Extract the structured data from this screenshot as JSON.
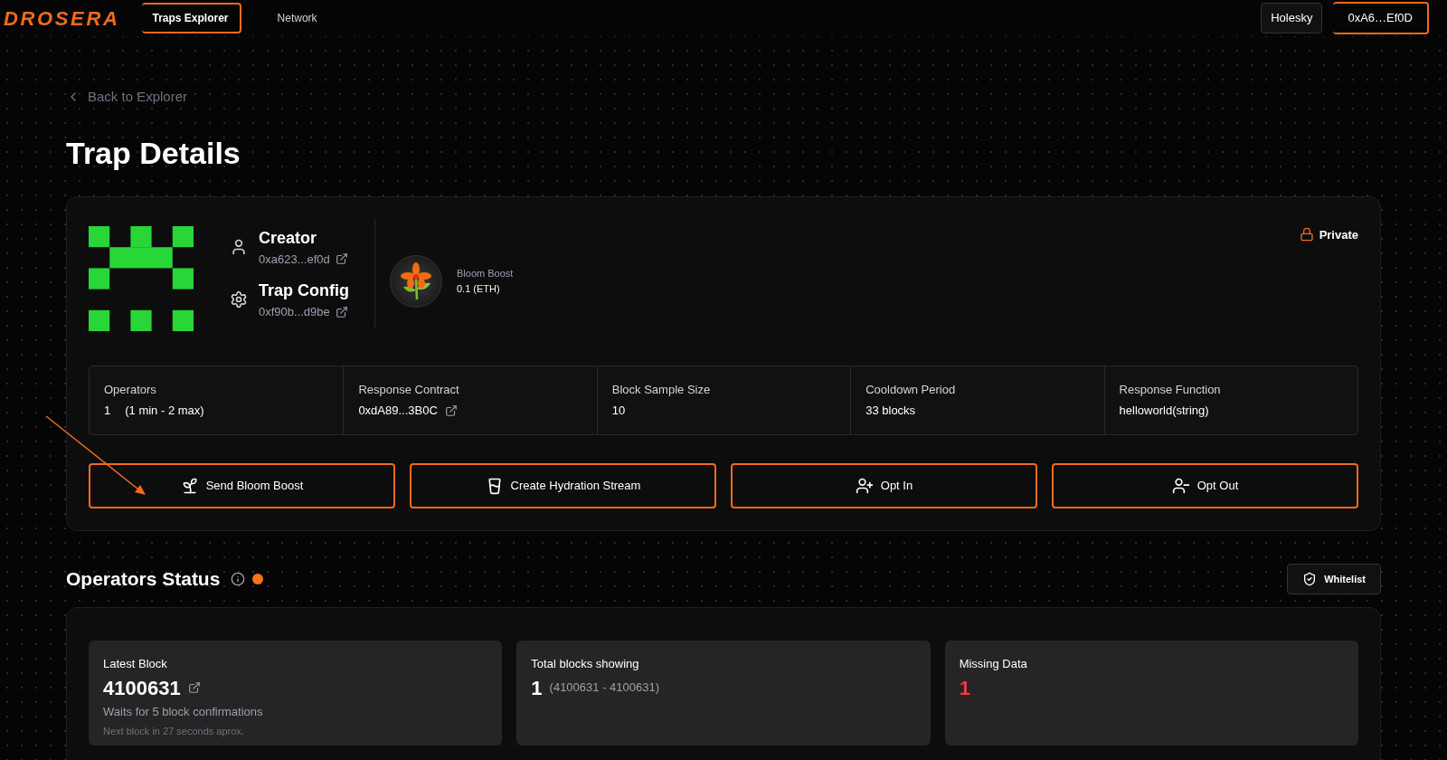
{
  "header": {
    "logo": "DROSERA",
    "nav": [
      {
        "label": "Traps Explorer",
        "selected": true
      },
      {
        "label": "Network",
        "selected": false
      }
    ],
    "network": "Holesky",
    "wallet": "0xA6…Ef0D"
  },
  "back_link": "Back to Explorer",
  "title": "Trap Details",
  "trap": {
    "creator": {
      "label": "Creator",
      "address": "0xa623...ef0d"
    },
    "config": {
      "label": "Trap Config",
      "address": "0xf90b...d9be"
    },
    "boost": {
      "label": "Bloom Boost",
      "amount": "0.1 (ETH)"
    },
    "visibility": {
      "label": "Private",
      "private": true
    },
    "details": [
      {
        "label": "Operators",
        "value": "1",
        "note": "(1 min - 2 max)",
        "link": false
      },
      {
        "label": "Response Contract",
        "value": "0xdA89...3B0C",
        "link": true
      },
      {
        "label": "Block Sample Size",
        "value": "10",
        "link": false
      },
      {
        "label": "Cooldown Period",
        "value": "33 blocks",
        "link": false
      },
      {
        "label": "Response Function",
        "value": "helloworld(string)",
        "link": false
      }
    ],
    "actions": [
      {
        "kind": "boost",
        "label": "Send Bloom Boost"
      },
      {
        "kind": "stream",
        "label": "Create Hydration Stream"
      },
      {
        "kind": "opt_in",
        "label": "Opt In"
      },
      {
        "kind": "opt_out",
        "label": "Opt Out"
      }
    ]
  },
  "operators_status": {
    "title": "Operators Status",
    "online": true,
    "whitelist": "Whitelist",
    "stats": [
      {
        "label": "Latest Block",
        "value": "4100631",
        "link": true,
        "alert": false,
        "note": "Waits for 5 block confirmations",
        "subnote": "Next block in 27 seconds aprox."
      },
      {
        "label": "Total blocks showing",
        "value": "1",
        "range": "(4100631 - 4100631)",
        "link": false,
        "alert": false
      },
      {
        "label": "Missing Data",
        "value": "1",
        "link": false,
        "alert": true
      }
    ]
  }
}
